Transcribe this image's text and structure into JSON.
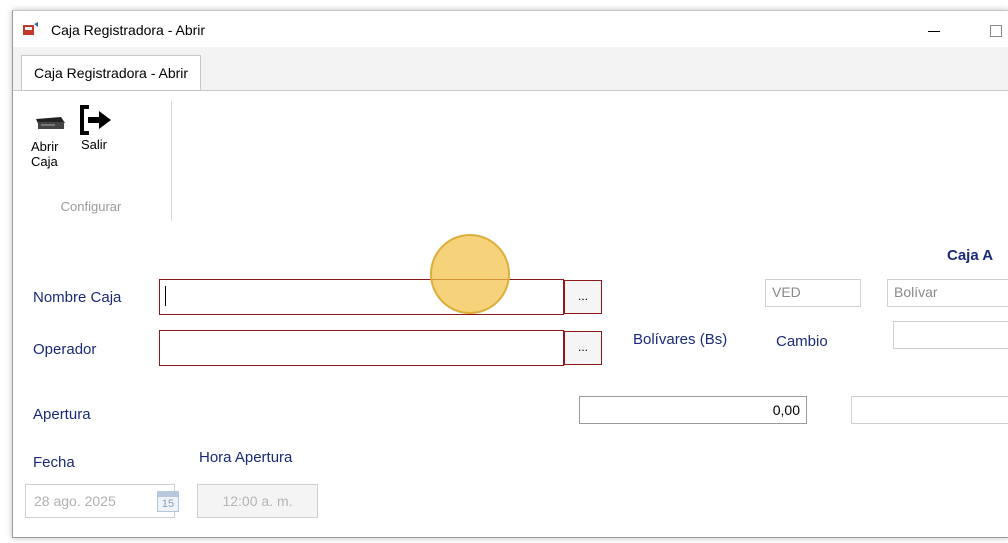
{
  "window": {
    "title": "Caja Registradora - Abrir"
  },
  "ribbon": {
    "tab_label": "Caja Registradora - Abrir",
    "buttons": [
      {
        "label_line1": "Abrir",
        "label_line2": "Caja",
        "icon": "cash-register-icon"
      },
      {
        "label": "Salir",
        "icon": "exit-icon"
      }
    ],
    "group_label": "Configurar"
  },
  "form": {
    "header_partial": "Caja A",
    "nombre_caja": {
      "label": "Nombre Caja",
      "value": "",
      "lookup_label": "..."
    },
    "operador": {
      "label": "Operador",
      "value": "",
      "lookup_label": "..."
    },
    "currency_code": "VED",
    "currency_name": "Bolívar",
    "bolivares_label": "Bolívares (Bs)",
    "cambio_label": "Cambio",
    "cambio_value": "",
    "apertura_label": "Apertura",
    "apertura_value": "0,00",
    "fecha_label": "Fecha",
    "fecha_value": "28 ago. 2025",
    "calendar_day": "15",
    "hora_apertura_label": "Hora Apertura",
    "hora_apertura_value": "12:00 a. m."
  },
  "colors": {
    "label_blue": "#1a2a78",
    "required_border": "#8c1a1a",
    "highlight": "#f3c246"
  }
}
